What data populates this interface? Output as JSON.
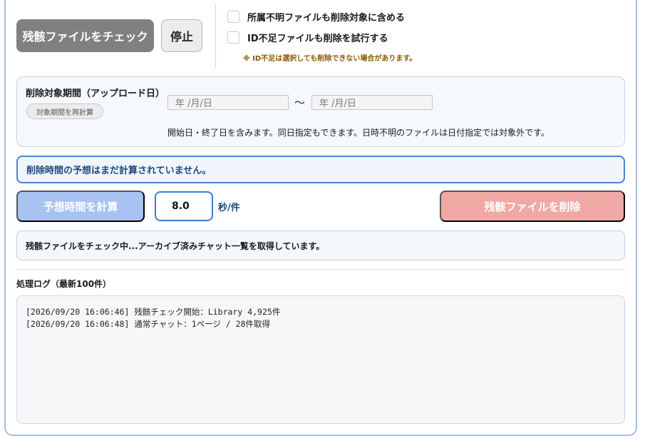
{
  "actions": {
    "check_label": "残骸ファイルをチェック",
    "stop_label": "停止"
  },
  "options": {
    "include_unknown_owner": "所属不明ファイルも削除対象に含める",
    "try_missing_id": "ID不足ファイルも削除を試行する",
    "note": "※ ID不足は選択しても削除できない場合があります。"
  },
  "period": {
    "title": "削除対象期間（アップロード日）",
    "recalc_label": "対象期間を再計算",
    "start_placeholder": "年 /月/日",
    "end_placeholder": "年 /月/日",
    "separator": "〜",
    "note": "開始日・終了日を含みます。同日指定もできます。日時不明のファイルは日付指定では対象外です。"
  },
  "estimate": {
    "message": "削除時間の予想はまだ計算されていません。",
    "calc_label": "予想時間を計算",
    "seconds_value": "8.0",
    "unit": "秒/件",
    "delete_label": "残骸ファイルを削除"
  },
  "status": {
    "message": "残骸ファイルをチェック中...アーカイブ済みチャット一覧を取得しています。"
  },
  "log": {
    "title": "処理ログ（最新100件）",
    "lines": [
      "[2026/09/20 16:06:46] 残骸チェック開始：Library 4,925件",
      "[2026/09/20 16:06:48] 通常チャット：1ページ / 28件取得"
    ]
  },
  "colors": {
    "check_button": "#808080",
    "estimate_button": "#a8c2f2",
    "delete_button": "#f0a8a5",
    "accent_border": "#4a84cf"
  }
}
